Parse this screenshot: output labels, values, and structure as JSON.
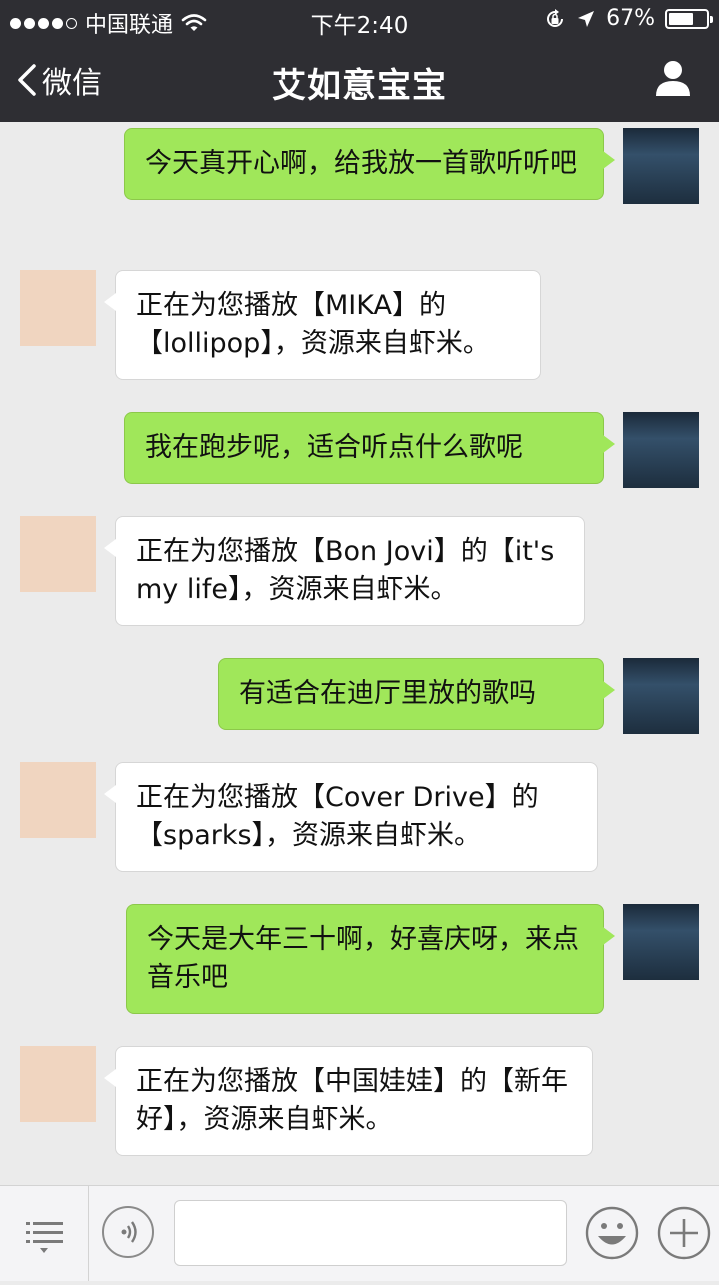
{
  "status_bar": {
    "carrier": "中国联通",
    "time": "下午2:40",
    "battery_percent": "67%",
    "battery_level": 0.67,
    "signal_bars": 4,
    "signal_max": 5,
    "icons": [
      "wifi-icon",
      "orientation-lock-icon",
      "location-arrow-icon",
      "battery-icon"
    ]
  },
  "nav": {
    "back_label": "微信",
    "title": "艾如意宝宝",
    "right_icon": "profile-icon"
  },
  "messages": [
    {
      "sender": "user",
      "text": "今天真开心啊，给我放一首歌听听吧"
    },
    {
      "sender": "bot",
      "text": "正在为您播放【MIKA】的【lollipop】，资源来自虾米。"
    },
    {
      "sender": "user",
      "text": "我在跑步呢，适合听点什么歌呢"
    },
    {
      "sender": "bot",
      "text": "正在为您播放【Bon Jovi】的【it's my life】，资源来自虾米。"
    },
    {
      "sender": "user",
      "text": "有适合在迪厅里放的歌吗"
    },
    {
      "sender": "bot",
      "text": "正在为您播放【Cover Drive】的【sparks】，资源来自虾米。"
    },
    {
      "sender": "user",
      "text": "今天是大年三十啊，好喜庆呀，来点音乐吧"
    },
    {
      "sender": "bot",
      "text": "正在为您播放【中国娃娃】的【新年好】，资源来自虾米。"
    }
  ],
  "input_bar": {
    "icons": [
      "menu-list-icon",
      "voice-icon",
      "emoji-icon",
      "plus-icon"
    ],
    "text_value": ""
  },
  "colors": {
    "header_bg": "#2e2e33",
    "chat_bg": "#ebebeb",
    "user_bubble": "#a0e75a",
    "bot_bubble": "#ffffff"
  }
}
